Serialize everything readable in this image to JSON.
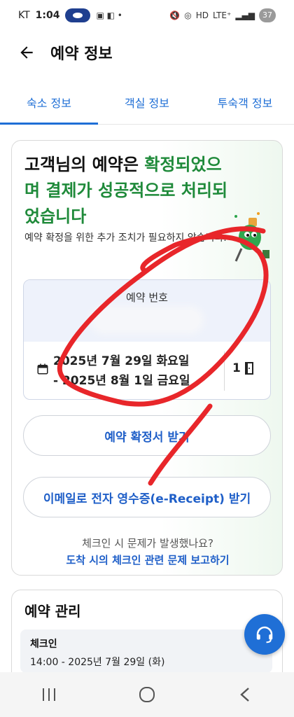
{
  "status_bar": {
    "carrier": "KT",
    "time": "1:04",
    "network": "LTE⁺",
    "battery": "37"
  },
  "app_bar": {
    "title": "예약 정보"
  },
  "tabs": [
    {
      "label": "숙소 정보",
      "active": true
    },
    {
      "label": "객실 정보",
      "active": false
    },
    {
      "label": "투숙객 정보",
      "active": false
    }
  ],
  "confirmation": {
    "title_part1": "고객님의 예약은 ",
    "title_highlight": "확정되었으며 결제가 성공적으로 처리되었습니다",
    "subtitle": "예약 확정을 위한 추가 조치가 필요하지 않습니다.",
    "booking_number_label": "예약 번호",
    "date_line1": "2025년 7월 29일 화요일",
    "date_line2": "- 2025년 8월 1일 금요일",
    "room_count": "1",
    "confirm_button": "예약 확정서 받기",
    "receipt_button": "이메일로 전자 영수증(e-Receipt) 받기",
    "help_question": "체크인 시 문제가 발생했나요?",
    "help_link": "도착 시의 체크인 관련 문제 보고하기"
  },
  "manage": {
    "title": "예약 관리",
    "checkin_label": "체크인",
    "checkin_value": "14:00 - 2025년 7월 29일 (화)"
  },
  "colors": {
    "accent_blue": "#1f6fd6",
    "highlight_green": "#1f8a3a",
    "annotation_red": "#e8262a"
  },
  "icons": [
    "back-arrow-icon",
    "calendar-icon",
    "door-icon",
    "headset-icon",
    "mascot-illustration",
    "nav-recents-icon",
    "nav-home-icon",
    "nav-back-icon"
  ]
}
